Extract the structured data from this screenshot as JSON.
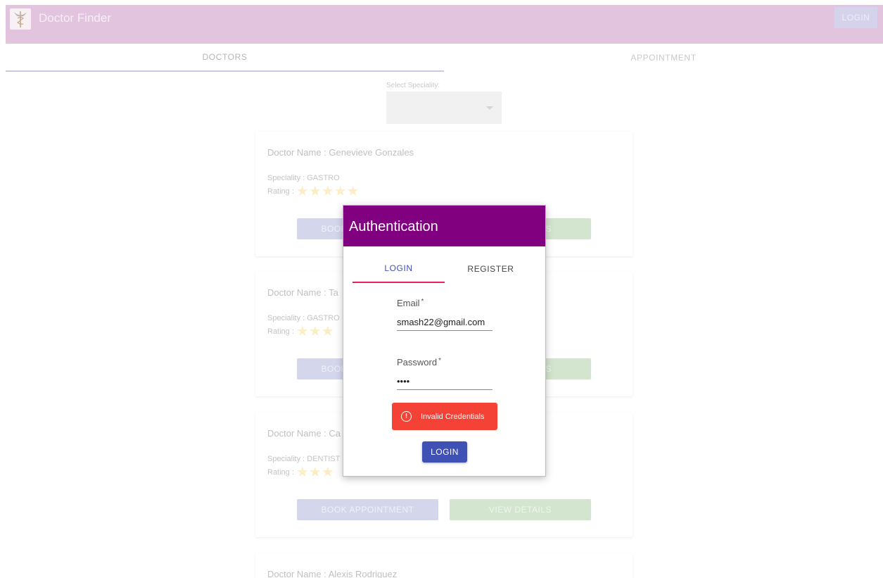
{
  "header": {
    "title": "Doctor Finder",
    "login_label": "LOGIN",
    "logo_icon": "caduceus-icon"
  },
  "nav": {
    "tabs": [
      {
        "label": "DOCTORS",
        "active": true
      },
      {
        "label": "APPOINTMENT",
        "active": false
      }
    ]
  },
  "filter": {
    "label": "Select Speciality:",
    "selected": ""
  },
  "doctors": [
    {
      "name": "Doctor Name : Genevieve Gonzales",
      "speciality": "Speciality : GASTRO",
      "rating_label": "Rating :",
      "rating": 5,
      "book_label": "BOOK APPOINTMENT",
      "view_label": "VIEW DETAILS"
    },
    {
      "name": "Doctor Name : Ta",
      "speciality": "Speciality : GASTRO",
      "rating_label": "Rating :",
      "rating": 3,
      "book_label": "BOOK APPOINTMENT",
      "view_label": "VIEW DETAILS"
    },
    {
      "name": "Doctor Name : Ca",
      "speciality": "Speciality : DENTIST",
      "rating_label": "Rating :",
      "rating": 3,
      "book_label": "BOOK APPOINTMENT",
      "view_label": "VIEW DETAILS"
    },
    {
      "name": "Doctor Name : Alexis Rodriguez",
      "speciality": "",
      "rating_label": "",
      "rating": 0,
      "book_label": "",
      "view_label": ""
    }
  ],
  "modal": {
    "title": "Authentication",
    "tabs": [
      {
        "label": "LOGIN",
        "active": true
      },
      {
        "label": "REGISTER",
        "active": false
      }
    ],
    "email": {
      "label": "Email",
      "required_mark": "*",
      "value": "smash22@gmail.com"
    },
    "password": {
      "label": "Password",
      "required_mark": "*",
      "value": "••••"
    },
    "error": {
      "text": "Invalid Credentials",
      "icon": "alert-circle-icon"
    },
    "submit_label": "LOGIN"
  },
  "colors": {
    "header_bg": "#e2c4de",
    "modal_header": "#800080",
    "primary": "#3f51b5",
    "tab_indicator": "#e91e63",
    "error": "#f44336",
    "star": "#fbeec7"
  }
}
